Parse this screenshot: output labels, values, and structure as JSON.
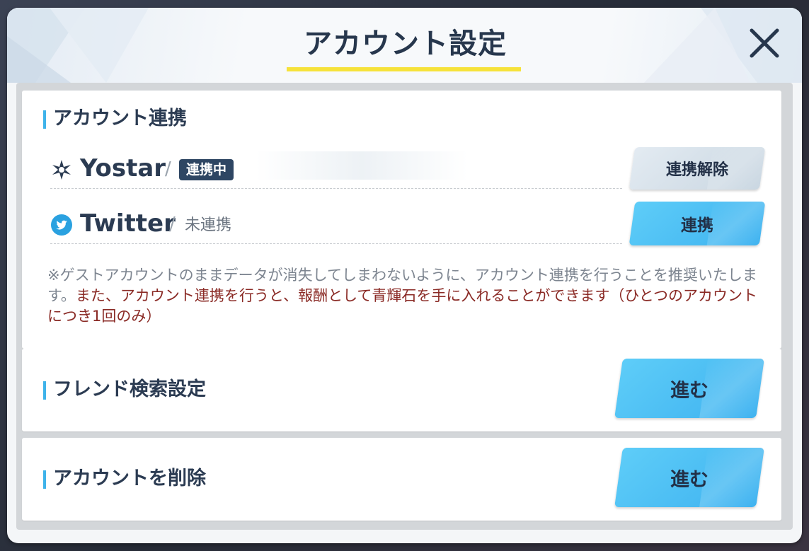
{
  "dialog": {
    "title": "アカウント設定",
    "close_label": "×"
  },
  "account_link": {
    "title": "アカウント連携",
    "yostar": {
      "name": "Yostar",
      "separator": "/",
      "status_badge": "連携中",
      "button_label": "連携解除",
      "icon": "yostar-logo-icon"
    },
    "twitter": {
      "name": "Twitter",
      "separator": "/",
      "status": "未連携",
      "button_label": "連携",
      "icon": "twitter-bird-icon"
    },
    "note_plain": "※ゲストアカウントのままデータが消失してしまわないように、アカウント連携を行うことを推奨いたします。",
    "note_highlight": "また、アカウント連携を行うと、報酬として青輝石を手に入れることができます（ひとつのアカウントにつき1回のみ）"
  },
  "friend_search": {
    "title": "フレンド検索設定",
    "button_label": "進む"
  },
  "delete_account": {
    "title": "アカウントを削除",
    "button_label": "進む"
  },
  "colors": {
    "accent_blue": "#3fb3ea",
    "title_underline": "#f6e23a",
    "badge_bg": "#2e4663",
    "note_highlight": "#8a2a25"
  }
}
